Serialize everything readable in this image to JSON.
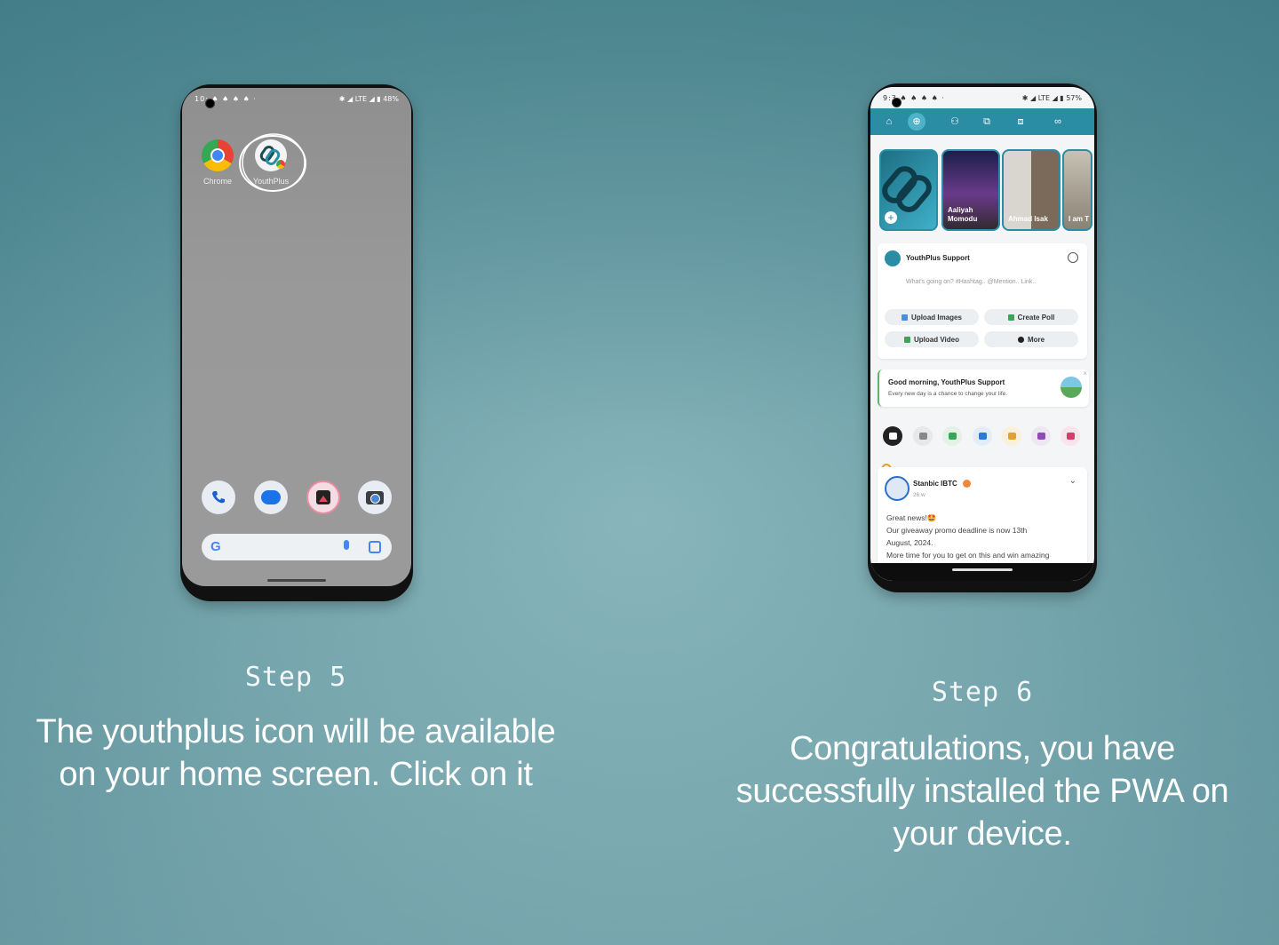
{
  "colors": {
    "accent": "#2a8da3",
    "background": "#6fa1a9"
  },
  "phone1": {
    "status_time": "10:",
    "status_dots": "♠ ♠ ♠ ♠ ·",
    "status_right": "✱ ◢ LTE ◢ ▮ 48%",
    "apps": [
      {
        "label": "Chrome",
        "icon": "chrome-icon"
      },
      {
        "label": "YouthPlus",
        "icon": "youthplus-link-icon"
      }
    ],
    "dock": [
      "phone-icon",
      "messages-icon",
      "gallery-icon",
      "camera-icon"
    ],
    "search": {
      "logo": "G",
      "icons": [
        "mic-icon",
        "lens-icon"
      ]
    }
  },
  "phone2": {
    "status_time": "9:3",
    "status_dots": "♠ ♠ ♠ ♠ ·",
    "status_right": "✱ ◢ LTE ◢ ▮ 57%",
    "nav_icons": [
      "home-icon",
      "add-circle-icon",
      "add-user-icon",
      "translate-icon",
      "translate-alt-icon",
      "link-icon"
    ],
    "stories": [
      {
        "label": ""
      },
      {
        "label": "Aaliyah Momodu"
      },
      {
        "label": "Ahmad Isak"
      },
      {
        "label": "I am T"
      }
    ],
    "composer": {
      "name": "YouthPlus Support",
      "placeholder": "What's going on? #Hashtag.. @Mention.. Link..",
      "buttons": [
        "Upload Images",
        "Create Poll",
        "Upload Video",
        "More"
      ]
    },
    "greeting": {
      "title": "Good morning, YouthPlus Support",
      "subtitle": "Every new day is a chance to change your life."
    },
    "categories": [
      "news",
      "text",
      "image",
      "video",
      "music",
      "file",
      "other"
    ],
    "post": {
      "author": "Stanbic IBTC",
      "time": "26 w",
      "line1": "Great news!🤩",
      "line2": "Our giveaway promo deadline is now 13th",
      "line3": "August, 2024.",
      "line4": "More time for you to get on this and win amazing"
    }
  },
  "captions": {
    "step5_title": "Step 5",
    "step5_text_line1": "The youthplus icon will be available",
    "step5_text_line2": "on your home screen. Click on it",
    "step6_title": "Step 6",
    "step6_text_line1": "Congratulations, you have",
    "step6_text_line2": "successfully installed the PWA on",
    "step6_text_line3": "your device."
  }
}
